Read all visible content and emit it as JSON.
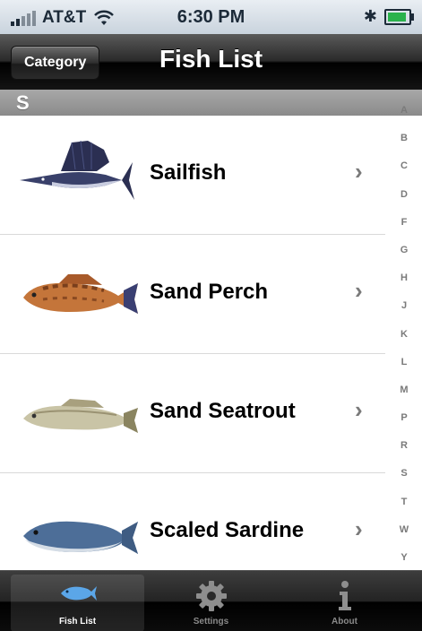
{
  "status_bar": {
    "carrier": "AT&T",
    "time": "6:30 PM",
    "battery_fraction": 0.9,
    "battery_color": "#2bb24c"
  },
  "nav": {
    "back_button": "Category",
    "title": "Fish List"
  },
  "section": {
    "letter": "S"
  },
  "fish": [
    {
      "name": "Sailfish",
      "icon": "sailfish-icon"
    },
    {
      "name": "Sand Perch",
      "icon": "sand-perch-icon"
    },
    {
      "name": "Sand Seatrout",
      "icon": "sand-seatrout-icon"
    },
    {
      "name": "Scaled Sardine",
      "icon": "scaled-sardine-icon"
    }
  ],
  "index_letters": [
    "A",
    "B",
    "C",
    "D",
    "F",
    "G",
    "H",
    "J",
    "K",
    "L",
    "M",
    "P",
    "R",
    "S",
    "T",
    "W",
    "Y"
  ],
  "tabs": [
    {
      "label": "Fish List",
      "icon": "fish-icon",
      "active": true
    },
    {
      "label": "Settings",
      "icon": "gear-icon",
      "active": false
    },
    {
      "label": "About",
      "icon": "info-icon",
      "active": false
    }
  ]
}
